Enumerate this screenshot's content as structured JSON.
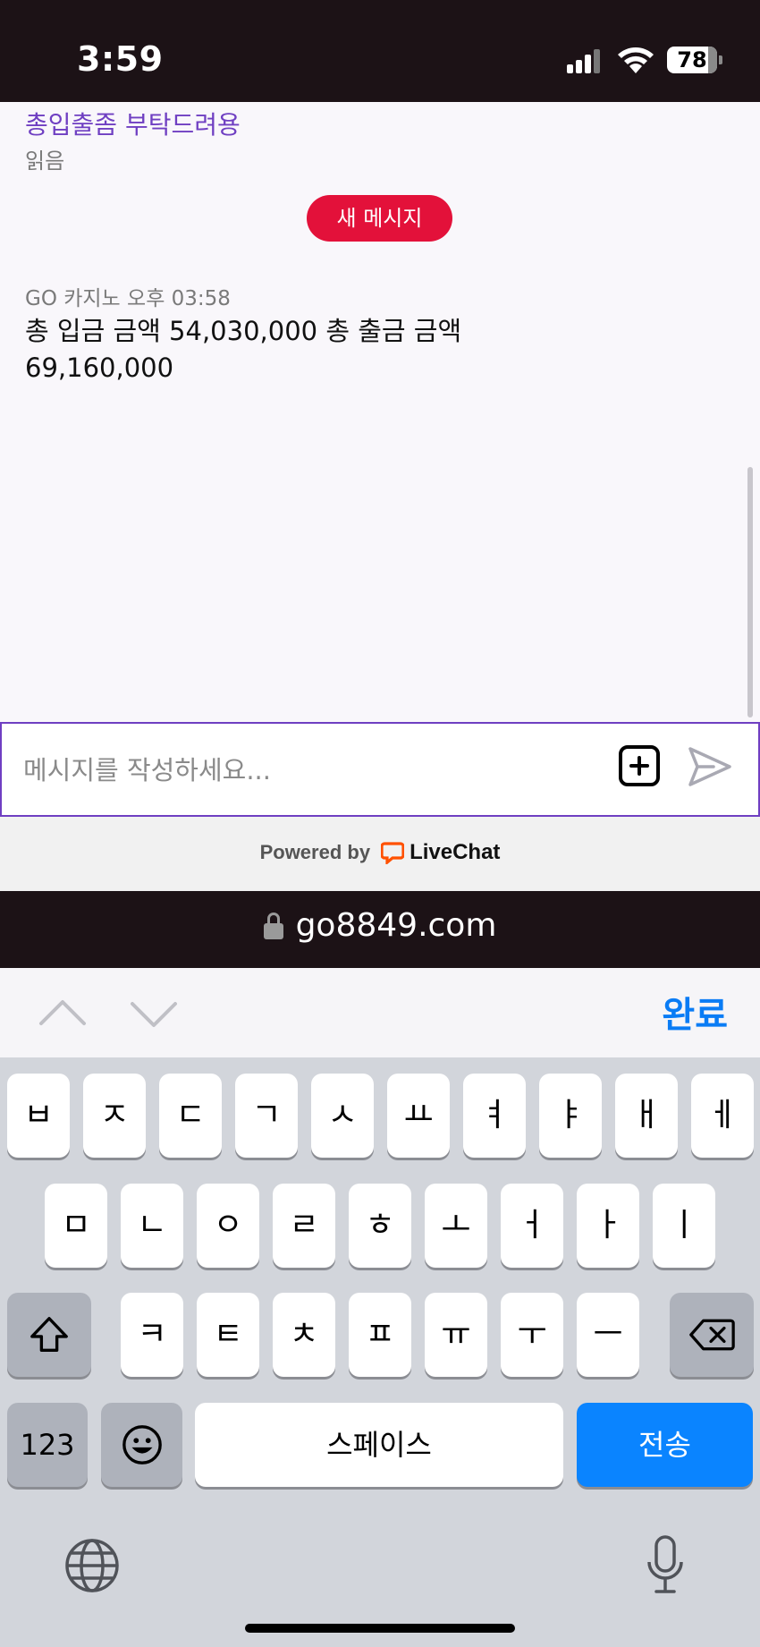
{
  "status_bar": {
    "time": "3:59",
    "battery": "78"
  },
  "chat": {
    "previous_message": "총입출좀 부탁드려용",
    "read_label": "읽음",
    "new_message_badge": "새 메시지",
    "message_meta": "GO 카지노 오후 03:58",
    "message_text": "총 입금 금액 54,030,000 총 출금 금액 69,160,000"
  },
  "composer": {
    "placeholder": "메시지를 작성하세요..."
  },
  "powered_by": {
    "prefix": "Powered by",
    "brand": "LiveChat",
    "brand_color": "#ff5100"
  },
  "browser": {
    "url": "go8849.com"
  },
  "keyboard_toolbar": {
    "done_label": "완료"
  },
  "keyboard": {
    "row1": [
      "ㅂ",
      "ㅈ",
      "ㄷ",
      "ㄱ",
      "ㅅ",
      "ㅛ",
      "ㅕ",
      "ㅑ",
      "ㅐ",
      "ㅔ"
    ],
    "row2": [
      "ㅁ",
      "ㄴ",
      "ㅇ",
      "ㄹ",
      "ㅎ",
      "ㅗ",
      "ㅓ",
      "ㅏ",
      "ㅣ"
    ],
    "row3": [
      "ㅋ",
      "ㅌ",
      "ㅊ",
      "ㅍ",
      "ㅠ",
      "ㅜ",
      "ㅡ"
    ],
    "numbers_label": "123",
    "space_label": "스페이스",
    "send_label": "전송"
  },
  "colors": {
    "accent_purple": "#6f3fc2",
    "badge_red": "#e3113a",
    "ios_blue": "#0a84ff"
  }
}
